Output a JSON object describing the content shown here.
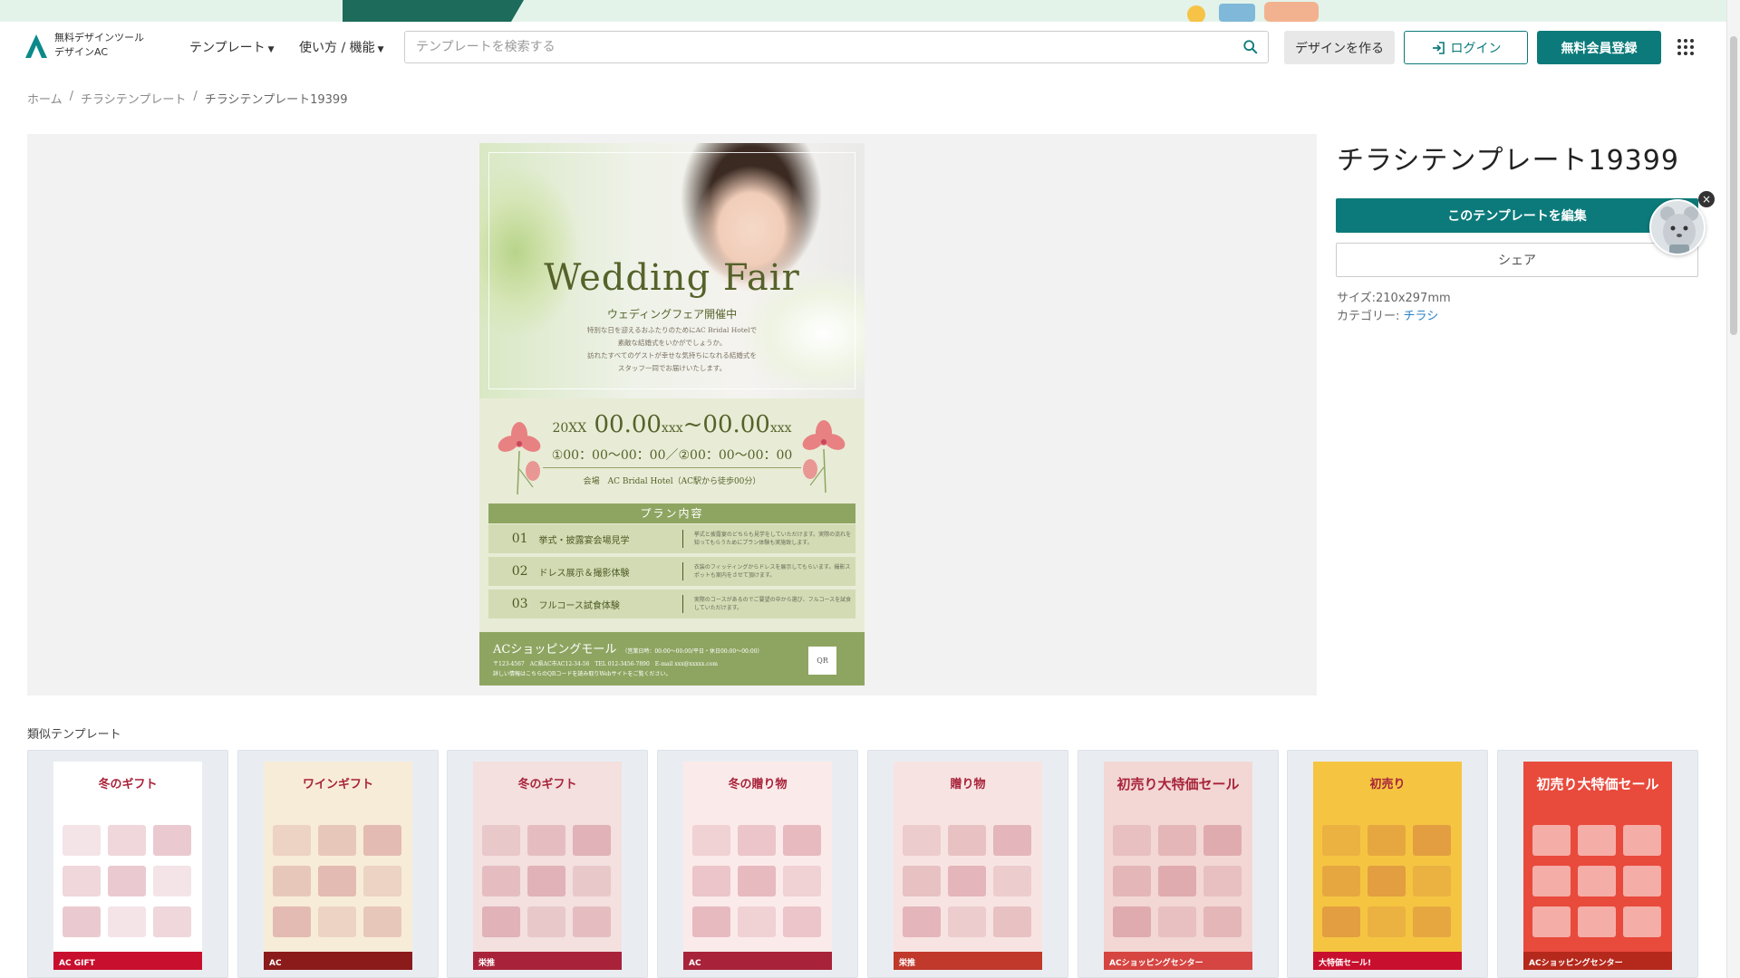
{
  "header": {
    "logo": {
      "line1": "無料デザインツール",
      "line2": "デザインAC"
    },
    "nav": [
      {
        "label": "テンプレート"
      },
      {
        "label": "使い方 / 機能"
      }
    ],
    "search": {
      "placeholder": "テンプレートを検索する",
      "value": ""
    },
    "buttons": {
      "design": "デザインを作る",
      "login": "ログイン",
      "register": "無料会員登録"
    },
    "colors": {
      "accent": "#0c7a7a",
      "link": "#2a82c8"
    }
  },
  "breadcrumb": {
    "items": [
      {
        "label": "ホーム"
      },
      {
        "label": "チラシテンプレート"
      },
      {
        "label": "チラシテンプレート19399"
      }
    ],
    "separator": "/"
  },
  "template": {
    "title": "チラシテンプレート19399",
    "edit_label": "このテンプレートを編集",
    "share_label": "シェア",
    "size_label": "サイズ:",
    "size_value": "210x297mm",
    "category_label": "カテゴリー:",
    "category_value": "チラシ"
  },
  "flyer": {
    "title": "Wedding Fair",
    "subtitle": "ウェディングフェア開催中",
    "body": [
      "特別な日を迎えるおふたりのためにAC Bridal Hotelで",
      "素敵な結婚式をいかがでしょうか。",
      "訪れたすべてのゲストが幸せな気持ちになれる結婚式を",
      "スタッフ一同でお届けいたします。"
    ],
    "date_year": "20XX",
    "date_from": "00.00",
    "date_unit": "xxx",
    "date_to": "00.00",
    "time": "①00：00〜00：00／②00：00〜00：00",
    "venue": "会場　AC Bridal Hotel（AC駅から徒歩00分）",
    "plan_heading": "プラン内容",
    "plans": [
      {
        "num": "01",
        "label": "挙式・披露宴会場見学",
        "desc": "挙式と披露宴のどちらも見学をしていただけます。実際の流れを知ってもらうためにプラン体験も実施致します。"
      },
      {
        "num": "02",
        "label": "ドレス展示＆撮影体験",
        "desc": "衣装のフィッティングからドレスを展示してもらいます。撮影スポットも案内をさせて頂けます。"
      },
      {
        "num": "03",
        "label": "フルコース試食体験",
        "desc": "実際のコースがあるのでご要望の中から選び、フルコースを試食していただけます。"
      }
    ],
    "mall_name": "ACショッピングモール",
    "mall_hours": "（営業日時：00:00〜00:00/平日・休日00:00〜00:00）",
    "mall_info": "〒123-4567　AC県AC市AC12-34-56　TEL 012-3456-7890　E-mail xxx@xxxxx.com",
    "mall_note": "詳しい情報はこちらのQRコードを読み取りWebサイトをご覧ください。",
    "qr_label": "QR"
  },
  "similar": {
    "title": "類似テンプレート",
    "cards": [
      {
        "head": "冬のギフト",
        "foot": "AC GIFT",
        "bg": "#ffffff",
        "foot_color": "#c8102e"
      },
      {
        "head": "ワインギフト",
        "foot": "AC",
        "bg": "#f7ecd8",
        "foot_color": "#8b1a1a"
      },
      {
        "head": "冬のギフト",
        "foot": "栄推",
        "bg": "#f3e0df",
        "foot_color": "#a8233a"
      },
      {
        "head": "冬の贈り物",
        "foot": "AC",
        "bg": "#fbeaea",
        "foot_color": "#a8233a"
      },
      {
        "head": "贈り物",
        "foot": "栄推",
        "bg": "#f7e4e2",
        "foot_color": "#c0392b"
      },
      {
        "head": "初売り大特価セール",
        "foot": "ACショッピングセンター",
        "bg": "#f2d7d4",
        "foot_color": "#d64541"
      },
      {
        "head": "初売り",
        "foot": "大特価セール!",
        "bg": "#f5c542",
        "foot_color": "#c8102e"
      },
      {
        "head": "初売り大特価セール",
        "foot": "ACショッピングセンター",
        "bg": "#e84a3c",
        "foot_color": "#b5291c"
      }
    ]
  }
}
